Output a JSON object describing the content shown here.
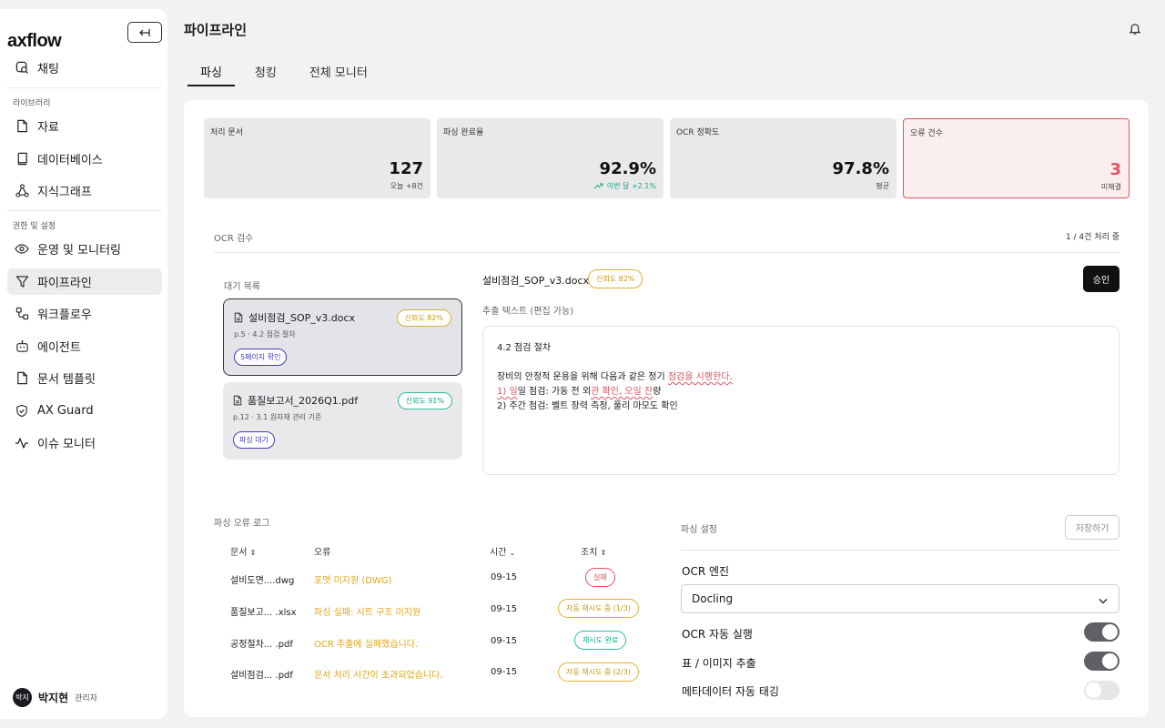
{
  "sidebar": {
    "logo": "axflow",
    "items_top": [
      {
        "label": "채팅",
        "icon": "chat-search-icon"
      }
    ],
    "section_library": "라이브러리",
    "library_items": [
      {
        "label": "자료",
        "icon": "file-icon"
      },
      {
        "label": "데이터베이스",
        "icon": "book-icon"
      },
      {
        "label": "지식그래프",
        "icon": "graph-icon"
      }
    ],
    "section_admin": "권한 및 설정",
    "admin_items": [
      {
        "label": "운영 및 모니터링",
        "icon": "eye-icon"
      },
      {
        "label": "파이프라인",
        "icon": "filter-icon",
        "active": true
      },
      {
        "label": "워크플로우",
        "icon": "workflow-icon"
      },
      {
        "label": "에이전트",
        "icon": "bot-icon"
      },
      {
        "label": "문서 템플릿",
        "icon": "file-icon"
      },
      {
        "label": "AX Guard",
        "icon": "shield-icon"
      },
      {
        "label": "이슈 모니터",
        "icon": "activity-icon"
      }
    ],
    "user": {
      "avatar": "박지",
      "name": "박지현",
      "role": "관리자"
    }
  },
  "header": {
    "title": "파이프라인"
  },
  "tabs": [
    "파싱",
    "청킹",
    "전체 모니터"
  ],
  "stats": [
    {
      "label": "처리 문서",
      "value": "127",
      "sub": "오늘 +8건"
    },
    {
      "label": "파싱 완료율",
      "value": "92.9%",
      "sub": "이번 달 +2.1%"
    },
    {
      "label": "OCR 정확도",
      "value": "97.8%",
      "sub": "평균"
    },
    {
      "label": "오류 건수",
      "value": "3",
      "sub": "미해결"
    }
  ],
  "ocr": {
    "section": "OCR 검수",
    "progress": "1 / 4건 처리 중",
    "queue_label": "대기 목록",
    "queue": [
      {
        "name": "설비점검_SOP_v3.docx",
        "sub": "p.5 · 4.2 점검 절차",
        "confidence": "신뢰도 82%",
        "status": "5페이지 확인"
      },
      {
        "name": "품질보고서_2026Q1.pdf",
        "sub": "p.12 · 3.1 원자재 관리 기준",
        "confidence": "신뢰도 91%",
        "status": "파싱 대기"
      }
    ],
    "doc_title": "설비점검_SOP_v3.docx",
    "doc_confidence": "신뢰도 82%",
    "approve": "승인",
    "extract_label": "추출 텍스트 (편집 가능)",
    "text": {
      "l1": "4.2 점검 절차",
      "l3a": "장비의 안정적 운용을 위해 다음과 같은 정기 ",
      "l3b": "점검을 시행한다.",
      "l4a": "1) 일",
      "l4b": "일 점검: 가동 전 외",
      "l4c": "관 확인, 오일 잔",
      "l4d": "량",
      "l5": "2) 주간 점검: 벨트 장력 측정, 풀리 마모도 확인"
    }
  },
  "error_log": {
    "title": "파싱 오류 로그",
    "headers": {
      "doc": "문서",
      "error": "오류",
      "time": "시간",
      "action": "조치"
    },
    "rows": [
      {
        "doc": "설비도면....dwg",
        "error": "포맷 미지원 (DWG)",
        "time": "09-15",
        "action": "실패"
      },
      {
        "doc": "품질보고... .xlsx",
        "error": "파싱 실패: 시트 구조 미지원",
        "time": "09-15",
        "action": "자동 재시도 중 (1/3)"
      },
      {
        "doc": "공정절차...  .pdf",
        "error": "OCR 추출에 실패했습니다.",
        "time": "09-15",
        "action": "재시도 완료"
      },
      {
        "doc": "설비점검...  .pdf",
        "error": "문서 처리 시간이 초과되었습니다.",
        "time": "09-15",
        "action": "자동 재시도 중 (2/3)"
      }
    ]
  },
  "settings": {
    "title": "파싱 설정",
    "save": "저장하기",
    "engine_label": "OCR 엔진",
    "engine_value": "Docling",
    "auto_ocr": "OCR 자동 실행",
    "table_extract": "표 / 이미지 추출",
    "metadata": "메타데이터 자동 태깅"
  }
}
